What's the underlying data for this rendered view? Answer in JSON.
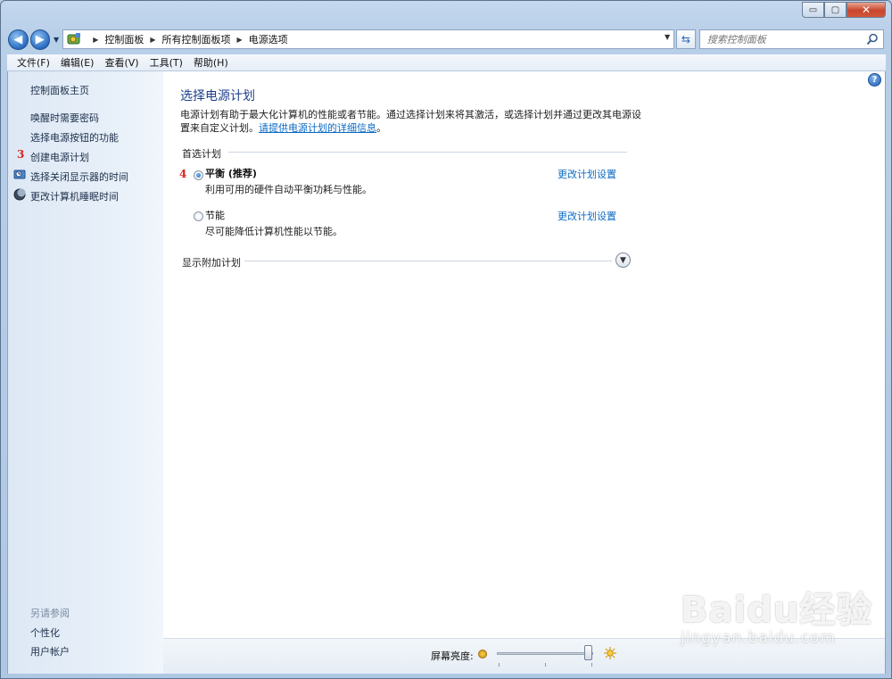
{
  "window": {
    "caption_buttons": {
      "minimize": "▭",
      "maximize": "▢",
      "close": "✕"
    }
  },
  "address_bar": {
    "breadcrumbs": [
      "控制面板",
      "所有控制面板项",
      "电源选项"
    ],
    "search_placeholder": "搜索控制面板"
  },
  "menu": [
    "文件(F)",
    "编辑(E)",
    "查看(V)",
    "工具(T)",
    "帮助(H)"
  ],
  "sidebar": {
    "home": "控制面板主页",
    "links": [
      "唤醒时需要密码",
      "选择电源按钮的功能",
      "创建电源计划",
      "选择关闭显示器的时间",
      "更改计算机睡眠时间"
    ],
    "see_also_label": "另请参阅",
    "see_also": [
      "个性化",
      "用户帐户"
    ]
  },
  "annotations": {
    "step3": "3",
    "step4": "4"
  },
  "main": {
    "title": "选择电源计划",
    "description": "电源计划有助于最大化计算机的性能或者节能。通过选择计划来将其激活，或选择计划并通过更改其电源设置来自定义计划。",
    "link": "请提供电源计划的详细信息",
    "link_suffix": "。",
    "preferred_label": "首选计划",
    "plans": [
      {
        "name": "平衡 (推荐)",
        "desc": "利用可用的硬件自动平衡功耗与性能。",
        "link": "更改计划设置",
        "selected": true
      },
      {
        "name": "节能",
        "desc": "尽可能降低计算机性能以节能。",
        "link": "更改计划设置",
        "selected": false
      }
    ],
    "show_additional": "显示附加计划"
  },
  "bottom": {
    "brightness_label": "屏幕亮度:",
    "brightness_level": 0.95
  },
  "watermark": {
    "brand": "Baidu经验",
    "url": "jingyan.baidu.com"
  }
}
